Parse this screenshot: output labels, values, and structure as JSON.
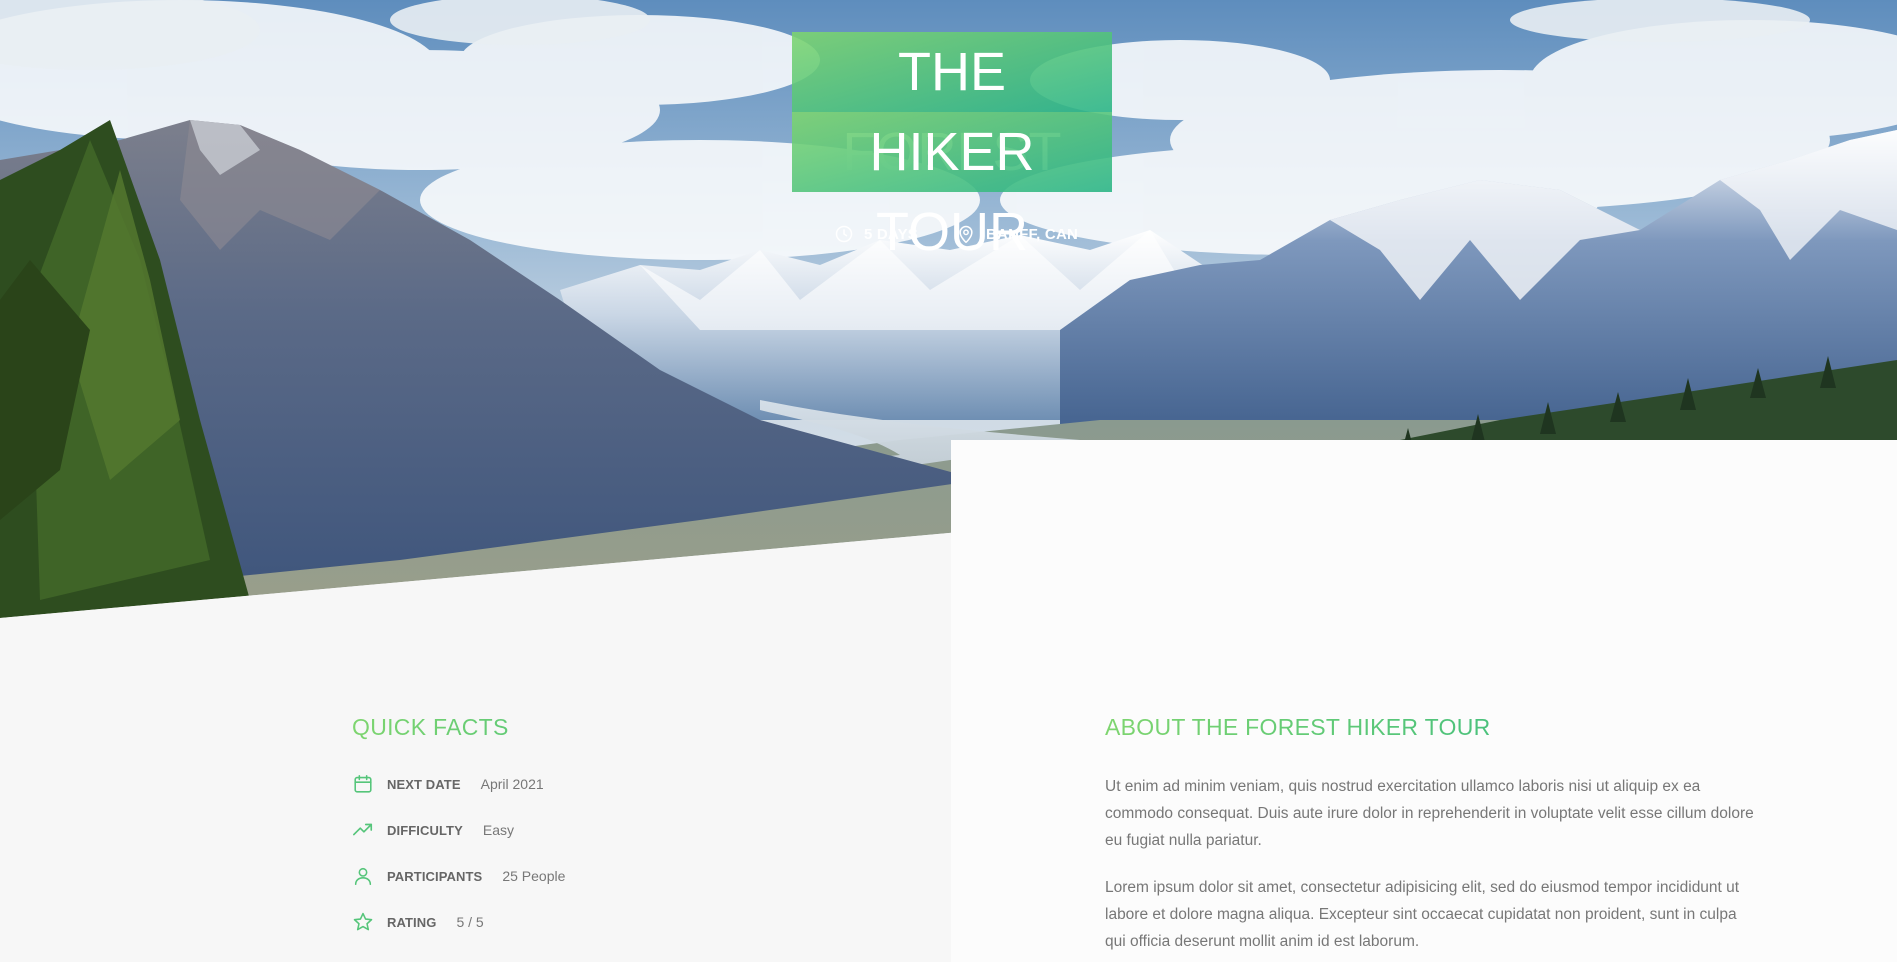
{
  "hero": {
    "title_line1": "THE FOREST",
    "title_line2": "HIKER TOUR",
    "duration": "5 DAYS",
    "location": "BANFF, CAN",
    "duration_icon": "clock-icon",
    "location_icon": "map-pin-icon"
  },
  "quick_facts": {
    "heading": "QUICK FACTS",
    "items": [
      {
        "icon": "calendar-icon",
        "label": "NEXT DATE",
        "value": "April 2021"
      },
      {
        "icon": "trending-up-icon",
        "label": "DIFFICULTY",
        "value": "Easy"
      },
      {
        "icon": "user-icon",
        "label": "PARTICIPANTS",
        "value": "25 People"
      },
      {
        "icon": "star-icon",
        "label": "RATING",
        "value": "5 / 5"
      }
    ]
  },
  "about": {
    "heading": "ABOUT THE FOREST HIKER TOUR",
    "paragraph1": "Ut enim ad minim veniam, quis nostrud exercitation ullamco laboris nisi ut aliquip ex ea commodo consequat. Duis aute irure dolor in reprehenderit in voluptate velit esse cillum dolore eu fugiat nulla pariatur.",
    "paragraph2": "Lorem ipsum dolor sit amet, consectetur adipisicing elit, sed do eiusmod tempor incididunt ut labore et dolore magna aliqua. Excepteur sint occaecat cupidatat non proident, sunt in culpa qui officia deserunt mollit anim id est laborum."
  },
  "colors": {
    "accent_light": "#7ed56f",
    "accent_dark": "#28b485",
    "text_muted": "#777777",
    "label": "#666666",
    "background": "#f7f7f7"
  }
}
